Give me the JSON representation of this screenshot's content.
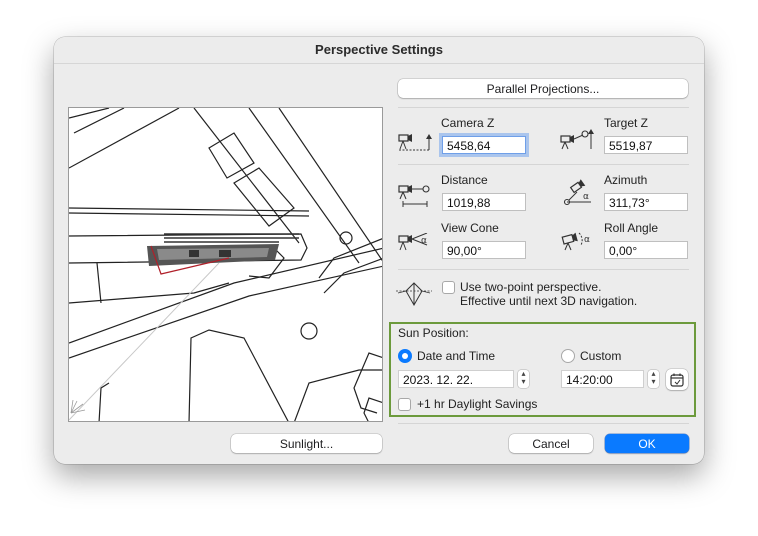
{
  "dialog": {
    "title": "Perspective Settings"
  },
  "buttons": {
    "parallel_projections": "Parallel Projections...",
    "sunlight": "Sunlight...",
    "cancel": "Cancel",
    "ok": "OK"
  },
  "camera": {
    "camera_z_label": "Camera Z",
    "camera_z_value": "5458,64",
    "target_z_label": "Target Z",
    "target_z_value": "5519,87",
    "distance_label": "Distance",
    "distance_value": "1019,88",
    "azimuth_label": "Azimuth",
    "azimuth_value": "311,73°",
    "view_cone_label": "View Cone",
    "view_cone_value": "90,00°",
    "roll_angle_label": "Roll Angle",
    "roll_angle_value": "0,00°"
  },
  "two_point": {
    "line1": "Use two-point perspective.",
    "line2": "Effective until next 3D navigation.",
    "checked": false
  },
  "sun": {
    "section_label": "Sun Position:",
    "date_time_label": "Date and Time",
    "custom_label": "Custom",
    "selected": "Date and Time",
    "date_value": "2023. 12. 22.",
    "time_value": "14:20:00",
    "daylight_label": "+1 hr Daylight Savings",
    "daylight_checked": false
  },
  "icons": {
    "camera_z": "camera-height-icon",
    "target_z": "target-height-icon",
    "distance": "camera-distance-icon",
    "azimuth": "azimuth-icon",
    "view_cone": "view-cone-icon",
    "roll_angle": "roll-angle-icon",
    "two_point": "two-point-perspective-icon",
    "calendar": "calendar-icon"
  },
  "colors": {
    "accent": "#0a7aff",
    "sun_box_border": "#6c9a3c",
    "camera_marker": "#b0202a"
  }
}
